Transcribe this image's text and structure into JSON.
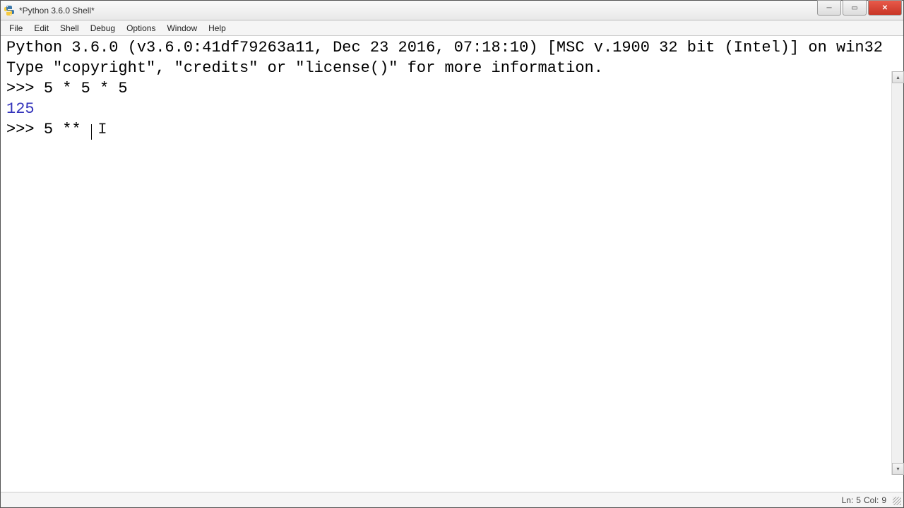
{
  "window": {
    "title": "*Python 3.6.0 Shell*"
  },
  "menu": {
    "items": [
      "File",
      "Edit",
      "Shell",
      "Debug",
      "Options",
      "Window",
      "Help"
    ]
  },
  "shell": {
    "banner1": "Python 3.6.0 (v3.6.0:41df79263a11, Dec 23 2016, 07:18:10) [MSC v.1900 32 bit (Intel)] on win32",
    "banner2": "Type \"copyright\", \"credits\" or \"license()\" for more information.",
    "prompt": ">>> ",
    "entry1": "5 * 5 * 5",
    "output1": "125",
    "entry2": "5 ** "
  },
  "status": {
    "line_label": "Ln:",
    "line_value": "5",
    "col_label": "Col:",
    "col_value": "9"
  }
}
